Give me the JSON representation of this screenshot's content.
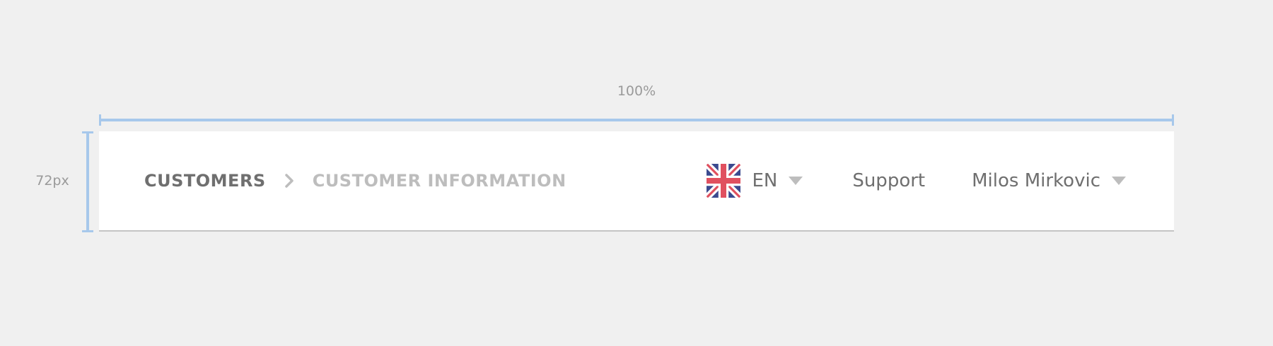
{
  "annotations": {
    "width_label": "100%",
    "height_label": "72px"
  },
  "header": {
    "breadcrumb": {
      "root": "CUSTOMERS",
      "separator_icon": "chevron-right-icon",
      "current": "CUSTOMER INFORMATION"
    },
    "language": {
      "flag_icon": "uk-flag-icon",
      "code": "EN",
      "caret_icon": "caret-down-icon"
    },
    "support_label": "Support",
    "user": {
      "name": "Milos Mirkovic",
      "caret_icon": "caret-down-icon"
    }
  },
  "colors": {
    "page_background": "#f0f0f0",
    "bar_background": "#ffffff",
    "annotation_blue": "#a7c8eb",
    "text_dark": "#6f6f6f",
    "text_muted": "#bdbdbd",
    "divider": "#c4c4c4"
  }
}
